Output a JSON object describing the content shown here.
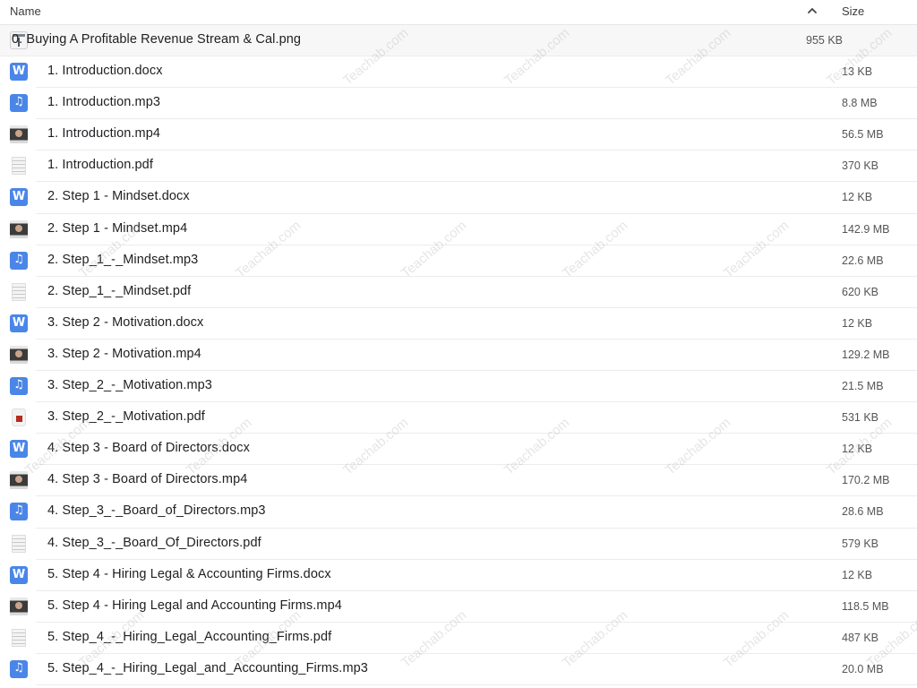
{
  "header": {
    "name_label": "Name",
    "size_label": "Size",
    "sort_icon": "chevron-up-icon"
  },
  "watermark_text": "Teachab.com",
  "files": [
    {
      "name": "0. Buying A Profitable Revenue Stream & Cal.png",
      "size": "955 KB",
      "type": "image"
    },
    {
      "name": "1. Introduction.docx",
      "size": "13 KB",
      "type": "word"
    },
    {
      "name": "1. Introduction.mp3",
      "size": "8.8 MB",
      "type": "audio"
    },
    {
      "name": "1. Introduction.mp4",
      "size": "56.5 MB",
      "type": "video"
    },
    {
      "name": "1. Introduction.pdf",
      "size": "370 KB",
      "type": "pdf"
    },
    {
      "name": "2. Step 1 - Mindset.docx",
      "size": "12 KB",
      "type": "word"
    },
    {
      "name": "2. Step 1 - Mindset.mp4",
      "size": "142.9 MB",
      "type": "video"
    },
    {
      "name": "2. Step_1_-_Mindset.mp3",
      "size": "22.6 MB",
      "type": "audio"
    },
    {
      "name": "2. Step_1_-_Mindset.pdf",
      "size": "620 KB",
      "type": "pdf"
    },
    {
      "name": "3. Step 2 - Motivation.docx",
      "size": "12 KB",
      "type": "word"
    },
    {
      "name": "3. Step 2 - Motivation.mp4",
      "size": "129.2 MB",
      "type": "video"
    },
    {
      "name": "3. Step_2_-_Motivation.mp3",
      "size": "21.5 MB",
      "type": "audio"
    },
    {
      "name": "3. Step_2_-_Motivation.pdf",
      "size": "531 KB",
      "type": "pdf-red"
    },
    {
      "name": "4. Step 3 - Board of Directors.docx",
      "size": "12 KB",
      "type": "word"
    },
    {
      "name": "4. Step 3 - Board of Directors.mp4",
      "size": "170.2 MB",
      "type": "video"
    },
    {
      "name": "4. Step_3_-_Board_of_Directors.mp3",
      "size": "28.6 MB",
      "type": "audio"
    },
    {
      "name": "4. Step_3_-_Board_Of_Directors.pdf",
      "size": "579 KB",
      "type": "pdf"
    },
    {
      "name": "5. Step 4 - Hiring Legal & Accounting Firms.docx",
      "size": "12 KB",
      "type": "word"
    },
    {
      "name": "5. Step 4 - Hiring Legal and Accounting Firms.mp4",
      "size": "118.5 MB",
      "type": "video"
    },
    {
      "name": "5. Step_4_-_Hiring_Legal_Accounting_Firms.pdf",
      "size": "487 KB",
      "type": "pdf"
    },
    {
      "name": "5. Step_4_-_Hiring_Legal_and_Accounting_Firms.mp3",
      "size": "20.0 MB",
      "type": "audio"
    }
  ]
}
